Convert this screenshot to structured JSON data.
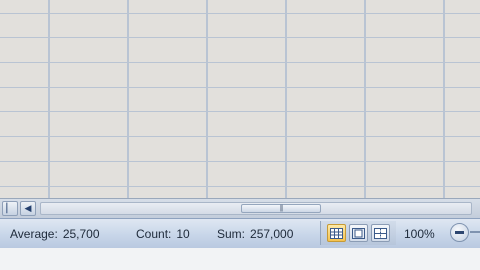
{
  "status": {
    "average_label": "Average:",
    "average_value": "25,700",
    "count_label": "Count:",
    "count_value": "10",
    "sum_label": "Sum:",
    "sum_value": "257,000",
    "zoom_level": "100%"
  },
  "view_buttons": [
    {
      "name": "normal-view",
      "active": true
    },
    {
      "name": "page-layout-view",
      "active": false
    },
    {
      "name": "page-break-preview",
      "active": false
    }
  ],
  "colors": {
    "grid_line": "#b9c4d3",
    "status_bar": "#c8d6e9",
    "active_view": "#f6c34f"
  },
  "icons": {
    "sheet_prev": "arrow-left",
    "sheet_first": "arrow-first",
    "zoom_out": "minus-circle"
  }
}
